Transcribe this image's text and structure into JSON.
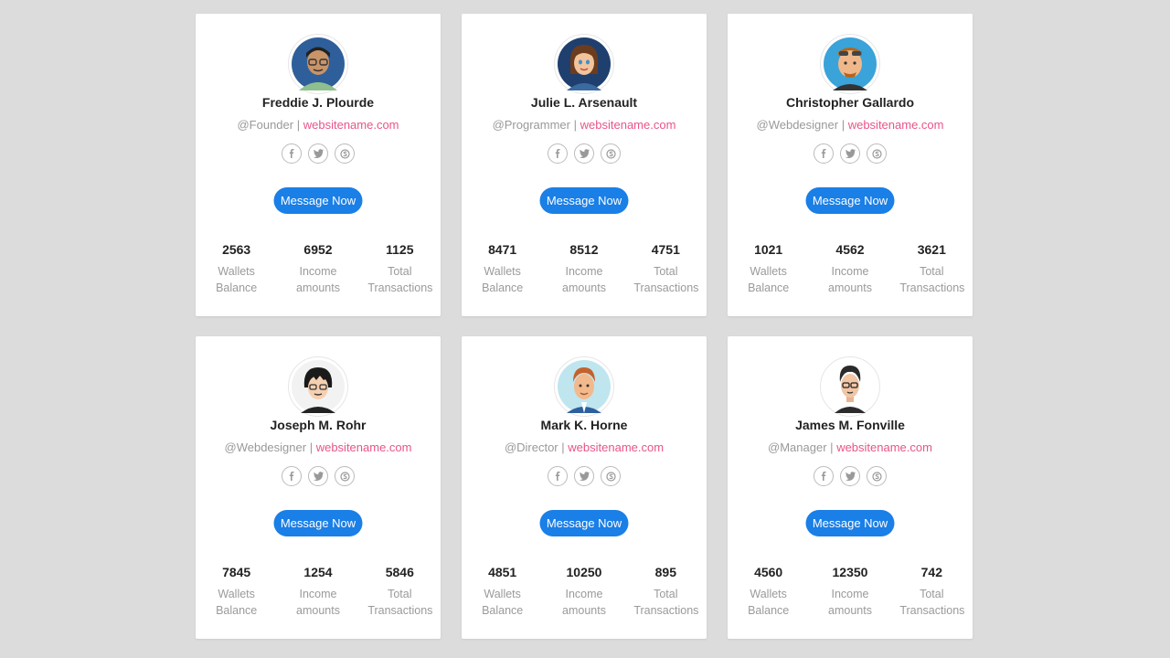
{
  "cards": [
    {
      "name": "Freddie J. Plourde",
      "role": "@Founder",
      "separator": "|",
      "site": "websitename.com",
      "button": "Message Now",
      "stats": [
        {
          "value": "2563",
          "label": "Wallets Balance"
        },
        {
          "value": "6952",
          "label": "Income amounts"
        },
        {
          "value": "1125",
          "label": "Total Transactions"
        }
      ],
      "avatar_icon": "avatar-man-glasses-icon"
    },
    {
      "name": "Julie L. Arsenault",
      "role": "@Programmer",
      "separator": "|",
      "site": "websitename.com",
      "button": "Message Now",
      "stats": [
        {
          "value": "8471",
          "label": "Wallets Balance"
        },
        {
          "value": "8512",
          "label": "Income amounts"
        },
        {
          "value": "4751",
          "label": "Total Transactions"
        }
      ],
      "avatar_icon": "avatar-woman-icon"
    },
    {
      "name": "Christopher Gallardo",
      "role": "@Webdesigner",
      "separator": "|",
      "site": "websitename.com",
      "button": "Message Now",
      "stats": [
        {
          "value": "1021",
          "label": "Wallets Balance"
        },
        {
          "value": "4562",
          "label": "Income amounts"
        },
        {
          "value": "3621",
          "label": "Total Transactions"
        }
      ],
      "avatar_icon": "avatar-man-sunglasses-icon"
    },
    {
      "name": "Joseph M. Rohr",
      "role": "@Webdesigner",
      "separator": "|",
      "site": "websitename.com",
      "button": "Message Now",
      "stats": [
        {
          "value": "7845",
          "label": "Wallets Balance"
        },
        {
          "value": "1254",
          "label": "Income amounts"
        },
        {
          "value": "5846",
          "label": "Total Transactions"
        }
      ],
      "avatar_icon": "avatar-man-dark-hair-icon"
    },
    {
      "name": "Mark K. Horne",
      "role": "@Director",
      "separator": "|",
      "site": "websitename.com",
      "button": "Message Now",
      "stats": [
        {
          "value": "4851",
          "label": "Wallets Balance"
        },
        {
          "value": "10250",
          "label": "Income amounts"
        },
        {
          "value": "895",
          "label": "Total Transactions"
        }
      ],
      "avatar_icon": "avatar-man-suit-icon"
    },
    {
      "name": "James M. Fonville",
      "role": "@Manager",
      "separator": "|",
      "site": "websitename.com",
      "button": "Message Now",
      "stats": [
        {
          "value": "4560",
          "label": "Wallets Balance"
        },
        {
          "value": "12350",
          "label": "Income amounts"
        },
        {
          "value": "742",
          "label": "Total Transactions"
        }
      ],
      "avatar_icon": "avatar-man-glasses-dark-icon"
    }
  ],
  "social_icons": [
    "facebook-icon",
    "twitter-icon",
    "skype-icon"
  ],
  "colors": {
    "background": "#dcdcdc",
    "card": "#ffffff",
    "button": "#1a7fe6",
    "link": "#e8548a",
    "muted": "#999999"
  }
}
